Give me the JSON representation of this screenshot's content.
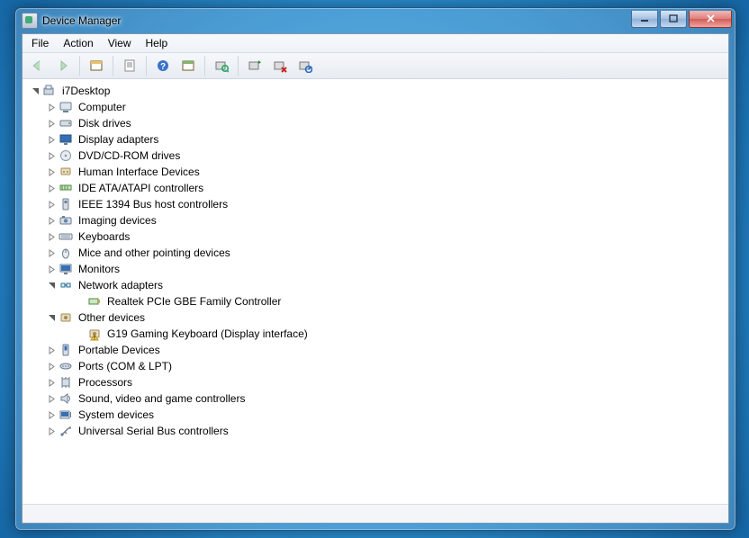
{
  "title": "Device Manager",
  "menus": [
    "File",
    "Action",
    "View",
    "Help"
  ],
  "toolbar": {
    "back": "Back",
    "forward": "Forward",
    "show_hidden": "Show hidden",
    "properties_sheet": "Properties sheet",
    "help": "Help",
    "action_list": "Action list",
    "scan": "Scan for hardware changes",
    "update": "Update driver",
    "uninstall": "Uninstall",
    "disable": "Disable"
  },
  "tree": {
    "root": "i7Desktop",
    "categories": [
      {
        "label": "Computer",
        "icon": "computer",
        "expanded": false,
        "children": []
      },
      {
        "label": "Disk drives",
        "icon": "disk",
        "expanded": false,
        "children": []
      },
      {
        "label": "Display adapters",
        "icon": "display",
        "expanded": false,
        "children": []
      },
      {
        "label": "DVD/CD-ROM drives",
        "icon": "dvd",
        "expanded": false,
        "children": []
      },
      {
        "label": "Human Interface Devices",
        "icon": "hid",
        "expanded": false,
        "children": []
      },
      {
        "label": "IDE ATA/ATAPI controllers",
        "icon": "ide",
        "expanded": false,
        "children": []
      },
      {
        "label": "IEEE 1394 Bus host controllers",
        "icon": "1394",
        "expanded": false,
        "children": []
      },
      {
        "label": "Imaging devices",
        "icon": "imaging",
        "expanded": false,
        "children": []
      },
      {
        "label": "Keyboards",
        "icon": "keyboard",
        "expanded": false,
        "children": []
      },
      {
        "label": "Mice and other pointing devices",
        "icon": "mouse",
        "expanded": false,
        "children": []
      },
      {
        "label": "Monitors",
        "icon": "monitor",
        "expanded": false,
        "children": []
      },
      {
        "label": "Network adapters",
        "icon": "network",
        "expanded": true,
        "children": [
          {
            "label": "Realtek PCIe GBE Family Controller",
            "icon": "nic",
            "warn": false
          }
        ]
      },
      {
        "label": "Other devices",
        "icon": "other",
        "expanded": true,
        "children": [
          {
            "label": "G19 Gaming Keyboard (Display interface)",
            "icon": "other",
            "warn": true
          }
        ]
      },
      {
        "label": "Portable Devices",
        "icon": "portable",
        "expanded": false,
        "children": []
      },
      {
        "label": "Ports (COM & LPT)",
        "icon": "ports",
        "expanded": false,
        "children": []
      },
      {
        "label": "Processors",
        "icon": "cpu",
        "expanded": false,
        "children": []
      },
      {
        "label": "Sound, video and game controllers",
        "icon": "sound",
        "expanded": false,
        "children": []
      },
      {
        "label": "System devices",
        "icon": "system",
        "expanded": false,
        "children": []
      },
      {
        "label": "Universal Serial Bus controllers",
        "icon": "usb",
        "expanded": false,
        "children": []
      }
    ]
  }
}
